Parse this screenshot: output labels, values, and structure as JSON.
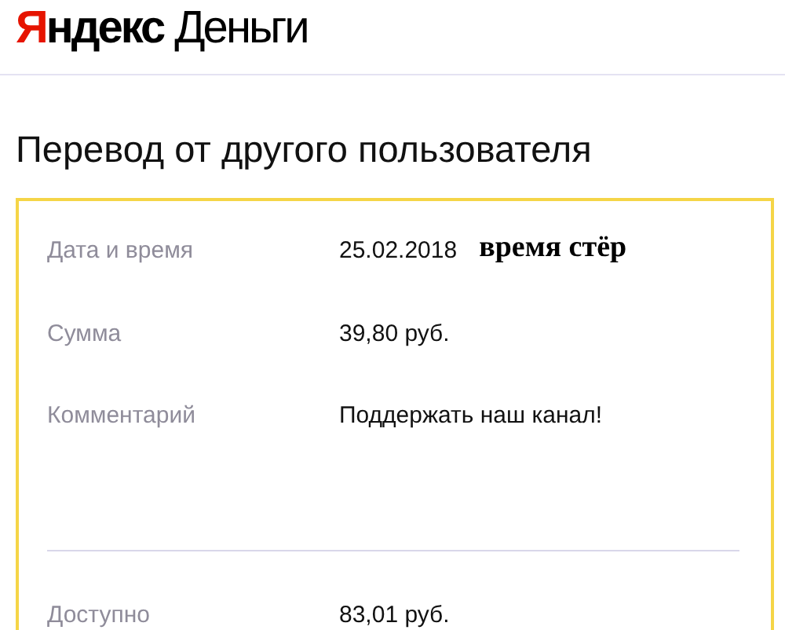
{
  "logo": {
    "accent": "Я",
    "rest": "ндекс",
    "product": "Деньги"
  },
  "title": "Перевод от другого пользователя",
  "details": [
    {
      "label": "Дата и время",
      "value": "25.02.2018",
      "note": "время стёр"
    },
    {
      "label": "Сумма",
      "value": "39,80 руб."
    },
    {
      "label": "Комментарий",
      "value": "Поддержать наш канал!"
    }
  ],
  "balance": {
    "label": "Доступно",
    "value": "83,01 руб."
  }
}
